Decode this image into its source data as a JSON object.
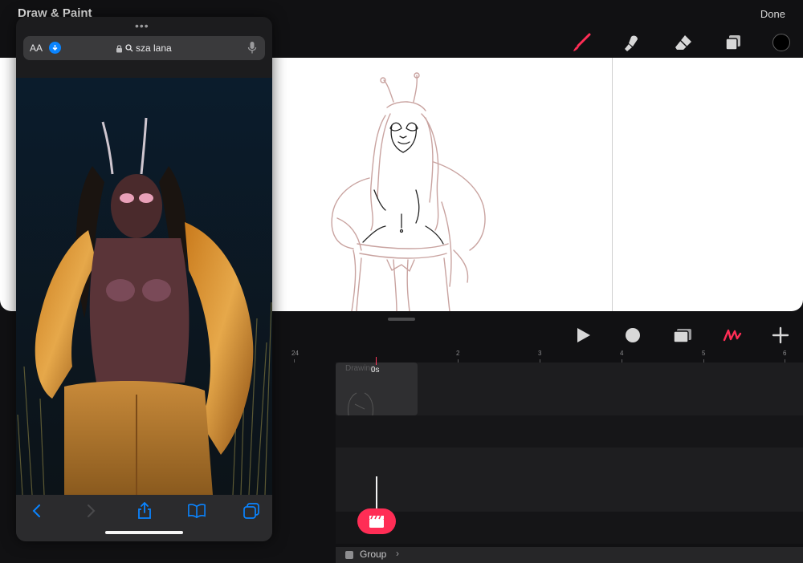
{
  "app": {
    "title": "Draw & Paint",
    "done_label": "Done"
  },
  "toolbar": {
    "tools": [
      "brush-icon",
      "smudge-icon",
      "eraser-icon",
      "layers-icon",
      "color-swatch"
    ],
    "accent": "#ff2d55",
    "current_color": "#000000"
  },
  "timeline": {
    "controls": [
      "play-icon",
      "record-icon",
      "onion-skin-icon",
      "draw-animation-icon",
      "plus-icon"
    ],
    "ruler_ticks": [
      "24",
      "2",
      "3",
      "4",
      "5",
      "6"
    ],
    "playhead_time": "0s",
    "clip_label": "Drawing",
    "group_label": "Group"
  },
  "safari": {
    "font_size_button": "AA",
    "url_text": "sza lana",
    "bottom_bar": [
      "back-icon",
      "forward-icon",
      "share-icon",
      "bookmarks-icon",
      "tabs-icon"
    ],
    "accent": "#0a84ff"
  }
}
